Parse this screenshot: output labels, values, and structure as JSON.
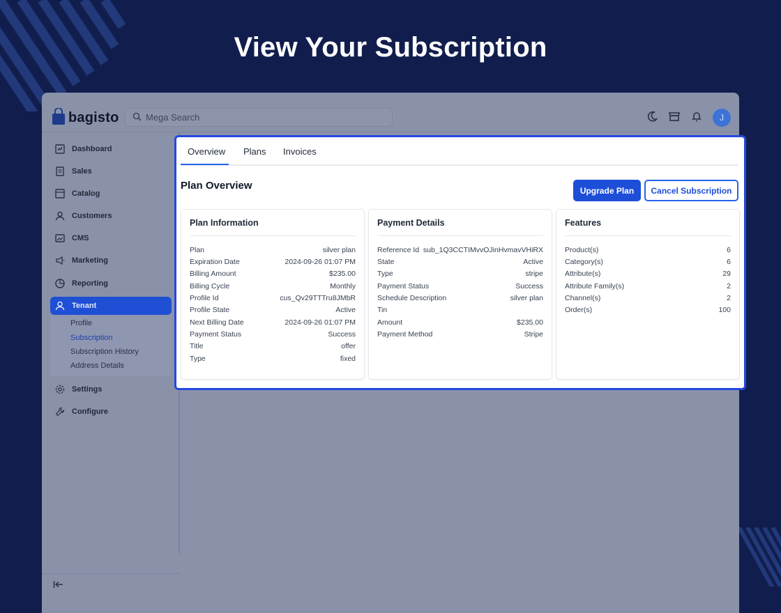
{
  "hero": {
    "title": "View Your Subscription"
  },
  "app": {
    "logo_text": "bagisto",
    "search_placeholder": "Mega Search",
    "avatar_initial": "J"
  },
  "sidebar": {
    "items": [
      {
        "label": "Dashboard",
        "icon": "dashboard-icon"
      },
      {
        "label": "Sales",
        "icon": "sales-icon"
      },
      {
        "label": "Catalog",
        "icon": "catalog-icon"
      },
      {
        "label": "Customers",
        "icon": "customers-icon"
      },
      {
        "label": "CMS",
        "icon": "cms-icon"
      },
      {
        "label": "Marketing",
        "icon": "marketing-icon"
      },
      {
        "label": "Reporting",
        "icon": "reporting-icon"
      },
      {
        "label": "Tenant",
        "icon": "tenant-icon"
      },
      {
        "label": "Settings",
        "icon": "settings-icon"
      },
      {
        "label": "Configure",
        "icon": "configure-icon"
      }
    ],
    "tenant_sub": [
      "Profile",
      "Subscription",
      "Subscription History",
      "Address Details"
    ]
  },
  "tabs": [
    "Overview",
    "Plans",
    "Invoices"
  ],
  "plan_overview": {
    "title": "Plan Overview",
    "upgrade_label": "Upgrade Plan",
    "cancel_label": "Cancel Subscription"
  },
  "plan_information": {
    "title": "Plan Information",
    "rows": [
      {
        "label": "Plan",
        "value": "silver plan"
      },
      {
        "label": "Expiration Date",
        "value": "2024-09-26 01:07 PM"
      },
      {
        "label": "Billing Amount",
        "value": "$235.00"
      },
      {
        "label": "Billing Cycle",
        "value": "Monthly"
      },
      {
        "label": "Profile Id",
        "value": "cus_Qv29TTTru8JMbR"
      },
      {
        "label": "Profile State",
        "value": "Active"
      },
      {
        "label": "Next Billing Date",
        "value": "2024-09-26 01:07 PM"
      },
      {
        "label": "Payment Status",
        "value": "Success"
      },
      {
        "label": "Title",
        "value": "offer"
      },
      {
        "label": "Type",
        "value": "fixed"
      }
    ]
  },
  "payment_details": {
    "title": "Payment Details",
    "rows": [
      {
        "label": "Reference Id",
        "value": "sub_1Q3CCTIMvvOJinHvmavVHiRX"
      },
      {
        "label": "State",
        "value": "Active"
      },
      {
        "label": "Type",
        "value": "stripe"
      },
      {
        "label": "Payment Status",
        "value": "Success"
      },
      {
        "label": "Schedule Description",
        "value": "silver plan"
      },
      {
        "label": "Tin",
        "value": ""
      },
      {
        "label": "Amount",
        "value": "$235.00"
      },
      {
        "label": "Payment Method",
        "value": "Stripe"
      }
    ]
  },
  "features": {
    "title": "Features",
    "rows": [
      {
        "label": "Product(s)",
        "value": "6"
      },
      {
        "label": "Category(s)",
        "value": "6"
      },
      {
        "label": "Attribute(s)",
        "value": "29"
      },
      {
        "label": "Attribute Family(s)",
        "value": "2"
      },
      {
        "label": "Channel(s)",
        "value": "2"
      },
      {
        "label": "Order(s)",
        "value": "100"
      }
    ]
  }
}
